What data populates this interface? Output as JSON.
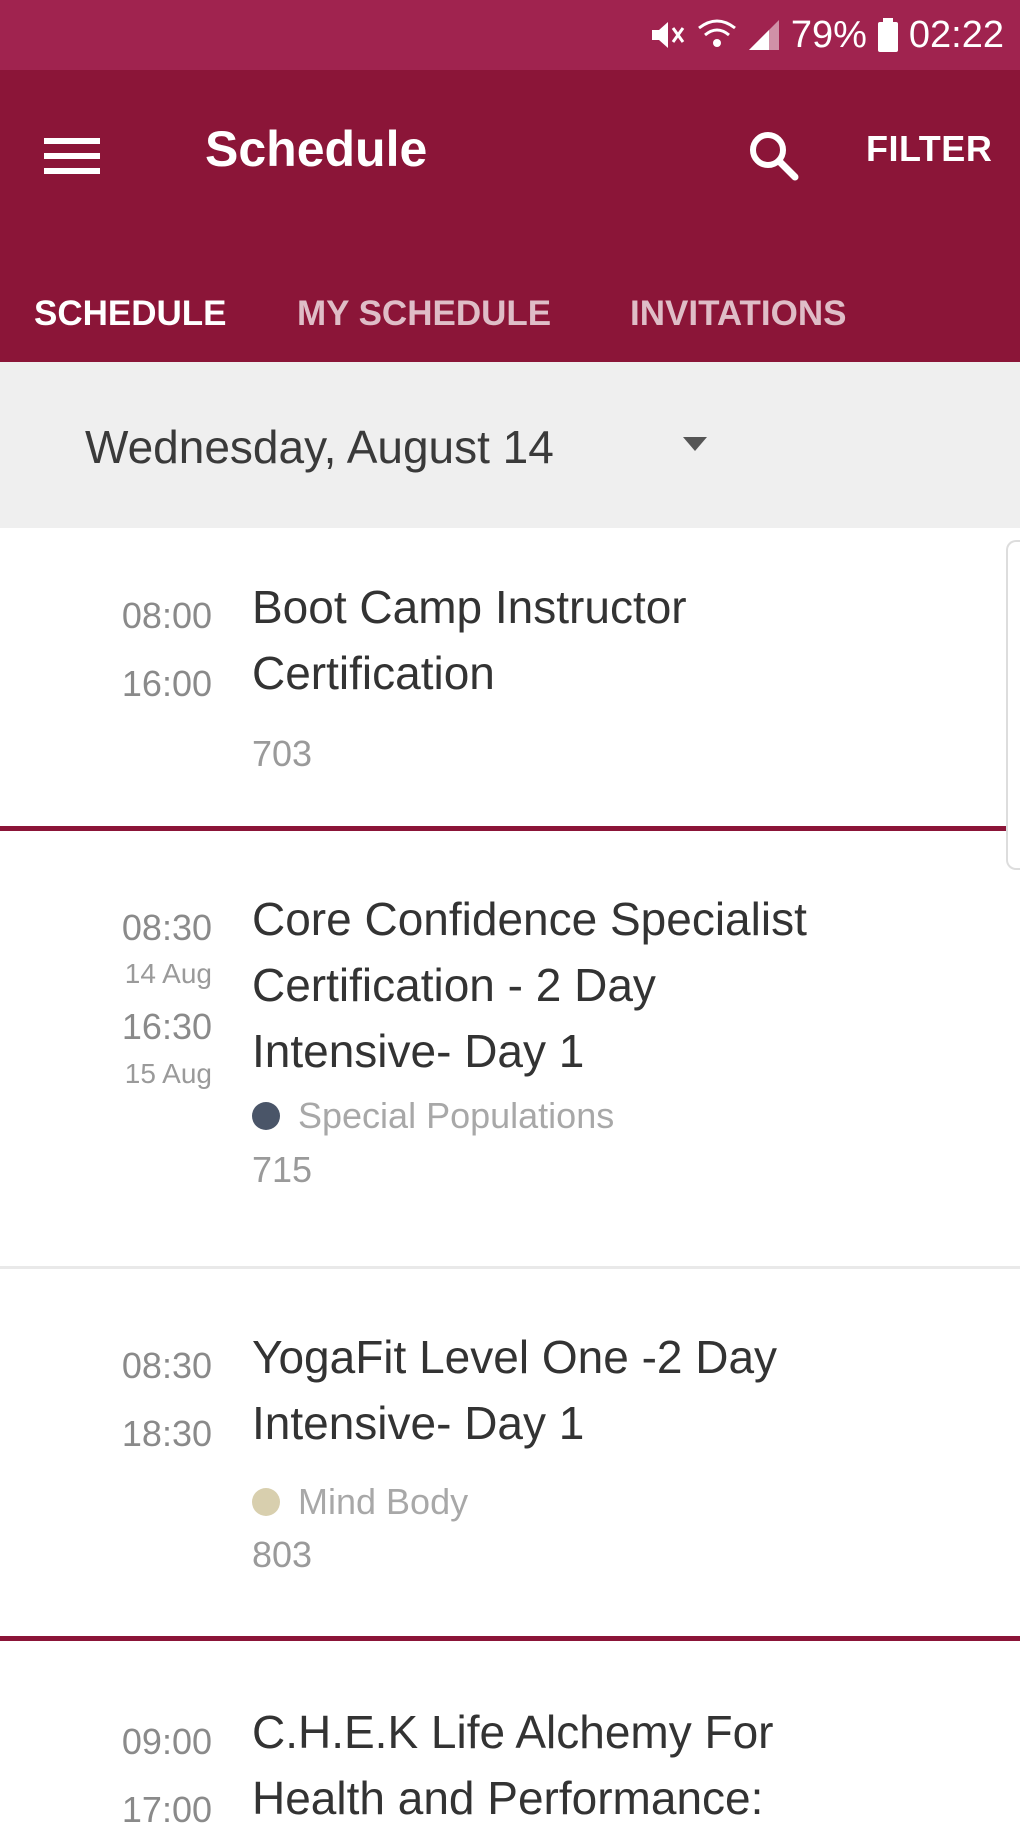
{
  "status_bar": {
    "battery": "79%",
    "time": "02:22"
  },
  "header": {
    "title": "Schedule",
    "filter_label": "FILTER"
  },
  "tabs": [
    {
      "label": "SCHEDULE"
    },
    {
      "label": "MY SCHEDULE"
    },
    {
      "label": "INVITATIONS"
    }
  ],
  "date_selector": {
    "value": "Wednesday, August 14"
  },
  "events": [
    {
      "start": "08:00",
      "end": "16:00",
      "title_lines": [
        "Boot Camp Instructor",
        "Certification"
      ],
      "room": "703"
    },
    {
      "start": "08:30",
      "start_date": "14 Aug",
      "end": "16:30",
      "end_date": "15 Aug",
      "title_lines": [
        "Core Confidence Specialist",
        "Certification - 2 Day",
        "Intensive- Day 1"
      ],
      "track": "Special Populations",
      "track_color": "#4a5568",
      "room": "715"
    },
    {
      "start": "08:30",
      "end": "18:30",
      "title_lines": [
        "YogaFit Level One -2 Day",
        "Intensive- Day 1"
      ],
      "track": "Mind Body",
      "track_color": "#d8cfae",
      "room": "803"
    },
    {
      "start": "09:00",
      "end": "17:00",
      "title_lines": [
        "C.H.E.K Life Alchemy For",
        "Health and Performance:"
      ]
    }
  ],
  "colors": {
    "status_bar": "#a0234f",
    "app_bar": "#8b1538",
    "accent": "#8b1538"
  }
}
